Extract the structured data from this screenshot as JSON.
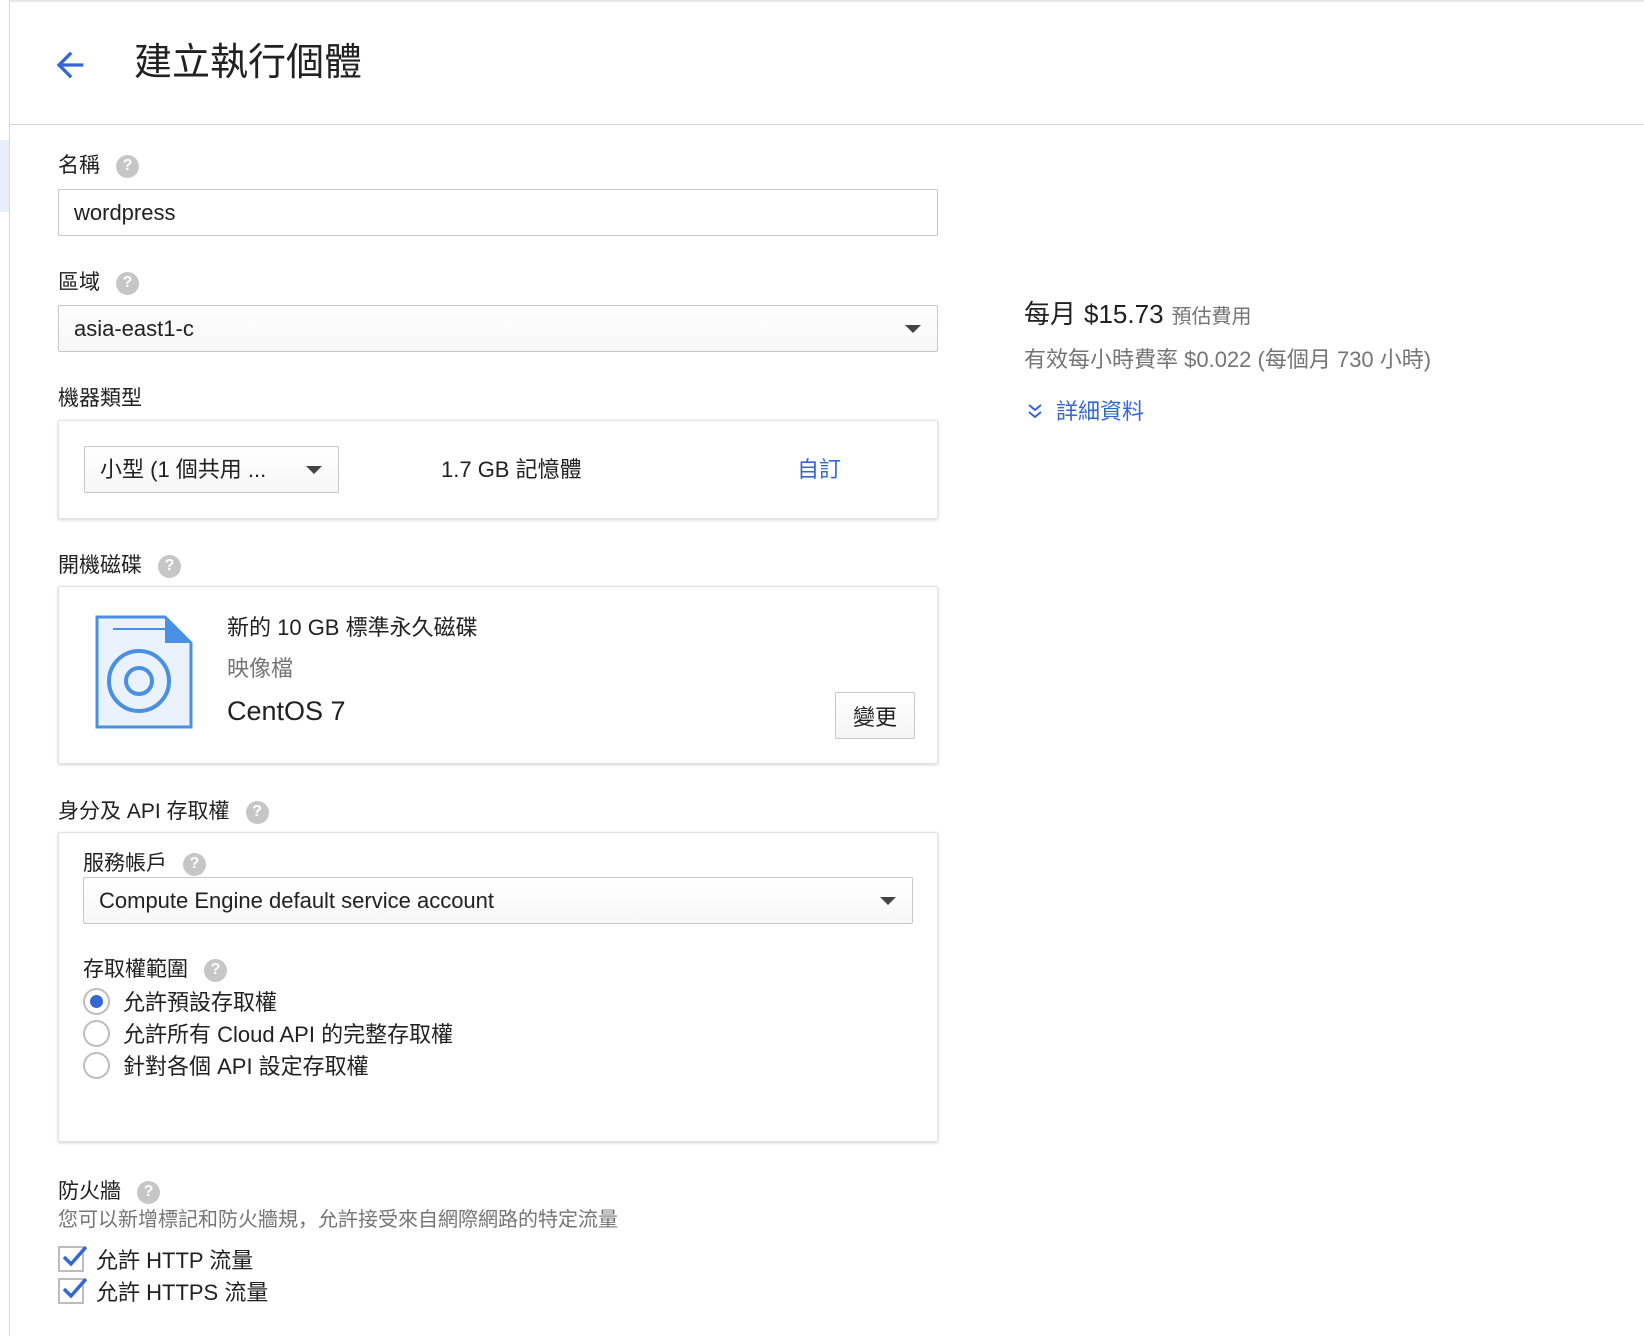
{
  "header": {
    "title": "建立執行個體"
  },
  "name_field": {
    "label": "名稱",
    "value": "wordpress"
  },
  "zone_field": {
    "label": "區域",
    "value": "asia-east1-c"
  },
  "machine_type": {
    "label": "機器類型",
    "selected": "小型 (1 個共用 ...",
    "memory": "1.7 GB 記憶體",
    "customize_label": "自訂"
  },
  "boot_disk": {
    "label": "開機磁碟",
    "description": "新的 10 GB 標準永久磁碟",
    "image_label": "映像檔",
    "image_value": "CentOS 7",
    "change_button": "變更"
  },
  "identity": {
    "label": "身分及 API 存取權",
    "service_account_label": "服務帳戶",
    "service_account_value": "Compute Engine default service account",
    "scopes_label": "存取權範圍",
    "scopes": [
      {
        "label": "允許預設存取權",
        "checked": true
      },
      {
        "label": "允許所有 Cloud API 的完整存取權",
        "checked": false
      },
      {
        "label": "針對各個 API 設定存取權",
        "checked": false
      }
    ]
  },
  "firewall": {
    "label": "防火牆",
    "description": "您可以新增標記和防火牆規，允許接受來自網際網路的特定流量",
    "options": [
      {
        "label": "允許 HTTP 流量",
        "checked": true
      },
      {
        "label": "允許 HTTPS 流量",
        "checked": true
      }
    ]
  },
  "pricing": {
    "monthly_prefix": "每月",
    "monthly_price": "$15.73",
    "monthly_suffix": "預估費用",
    "hourly_text": "有效每小時費率 $0.022 (每個月 730 小時)",
    "details_link": "詳細資料"
  },
  "colors": {
    "accent_blue": "#3367d6",
    "help_gray": "#c6c6c6",
    "border_gray": "#c7c7c7"
  }
}
